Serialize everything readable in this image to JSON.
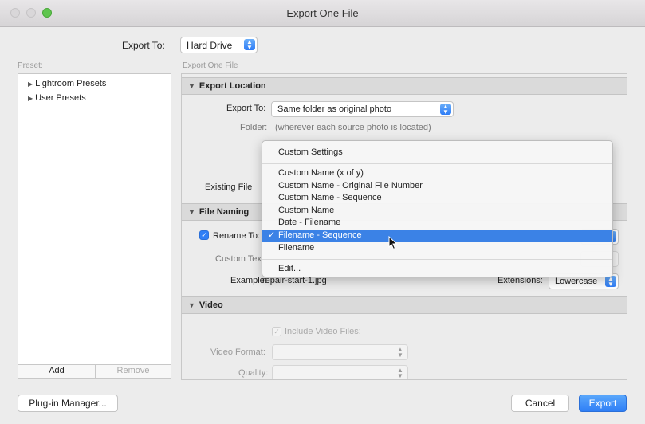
{
  "window": {
    "title": "Export One File"
  },
  "export_to": {
    "label": "Export To:",
    "value": "Hard Drive"
  },
  "preset": {
    "label": "Preset:",
    "items": [
      "Lightroom Presets",
      "User Presets"
    ],
    "add_label": "Add",
    "remove_label": "Remove"
  },
  "panel": {
    "breadcrumb": "Export One File",
    "export_location": {
      "header": "Export Location",
      "export_to_label": "Export To:",
      "export_to_value": "Same folder as original photo",
      "folder_label": "Folder:",
      "folder_value": "(wherever each source photo is located)",
      "existing_label": "Existing File"
    },
    "file_naming": {
      "header": "File Naming",
      "rename_label": "Rename To:",
      "custom_text_label": "Custom Tex",
      "example_label": "Example:",
      "example_value": "repair-start-1.jpg",
      "extensions_label": "Extensions:",
      "extensions_value": "Lowercase"
    },
    "video": {
      "header": "Video",
      "include_label": "Include Video Files:",
      "format_label": "Video Format:",
      "quality_label": "Quality:"
    }
  },
  "dropdown": {
    "header": "Custom Settings",
    "items": [
      "Custom Name (x of y)",
      "Custom Name - Original File Number",
      "Custom Name - Sequence",
      "Custom Name",
      "Date - Filename",
      "Filename - Sequence",
      "Filename"
    ],
    "selected": "Filename - Sequence",
    "edit": "Edit..."
  },
  "buttons": {
    "plugin_manager": "Plug-in Manager...",
    "cancel": "Cancel",
    "export": "Export"
  }
}
